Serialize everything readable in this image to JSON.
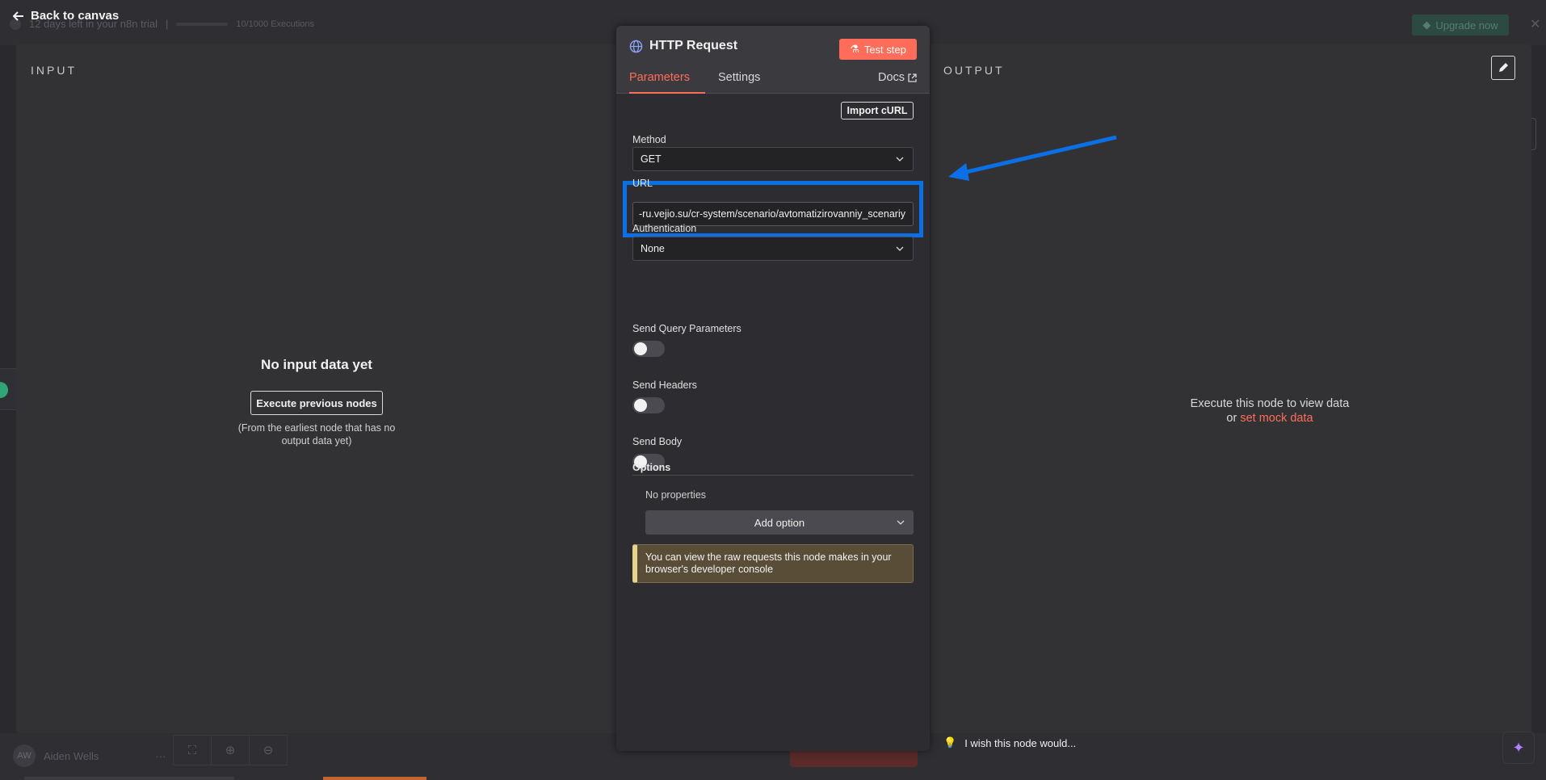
{
  "background": {
    "trial_text": "12 days left in your n8n trial",
    "executions": "10/1000 Executions",
    "upgrade_label": "Upgrade now",
    "user_initials": "AW",
    "user_name": "Aiden Wells"
  },
  "header": {
    "back_label": "Back to canvas"
  },
  "input_panel": {
    "title": "INPUT",
    "empty_heading": "No input data yet",
    "execute_previous_label": "Execute previous nodes",
    "hint": "(From the earliest node that has no output data yet)"
  },
  "node": {
    "title": "HTTP Request",
    "test_step_label": "Test step",
    "tabs": [
      {
        "label": "Parameters",
        "active": true
      },
      {
        "label": "Settings",
        "active": false
      },
      {
        "label": "Docs",
        "active": false
      }
    ],
    "import_curl_label": "Import cURL",
    "method_label": "Method",
    "method_value": "GET",
    "url_label": "URL",
    "url_value": "-ru.vejio.su/cr-system/scenario/avtomatizirovanniy_scenariy",
    "auth_label": "Authentication",
    "auth_value": "None",
    "send_query_label": "Send Query Parameters",
    "send_headers_label": "Send Headers",
    "send_body_label": "Send Body",
    "options_label": "Options",
    "no_properties": "No properties",
    "add_option_label": "Add option",
    "notice": "You can view the raw requests this node makes in your browser's developer console"
  },
  "output_panel": {
    "title": "OUTPUT",
    "message_line1": "Execute this node to view data",
    "message_or": "or ",
    "mock_link": "set mock data",
    "wish_label": "I wish this node would..."
  },
  "colors": {
    "accent": "#ff6d5a",
    "highlight": "#0b6fe6"
  }
}
